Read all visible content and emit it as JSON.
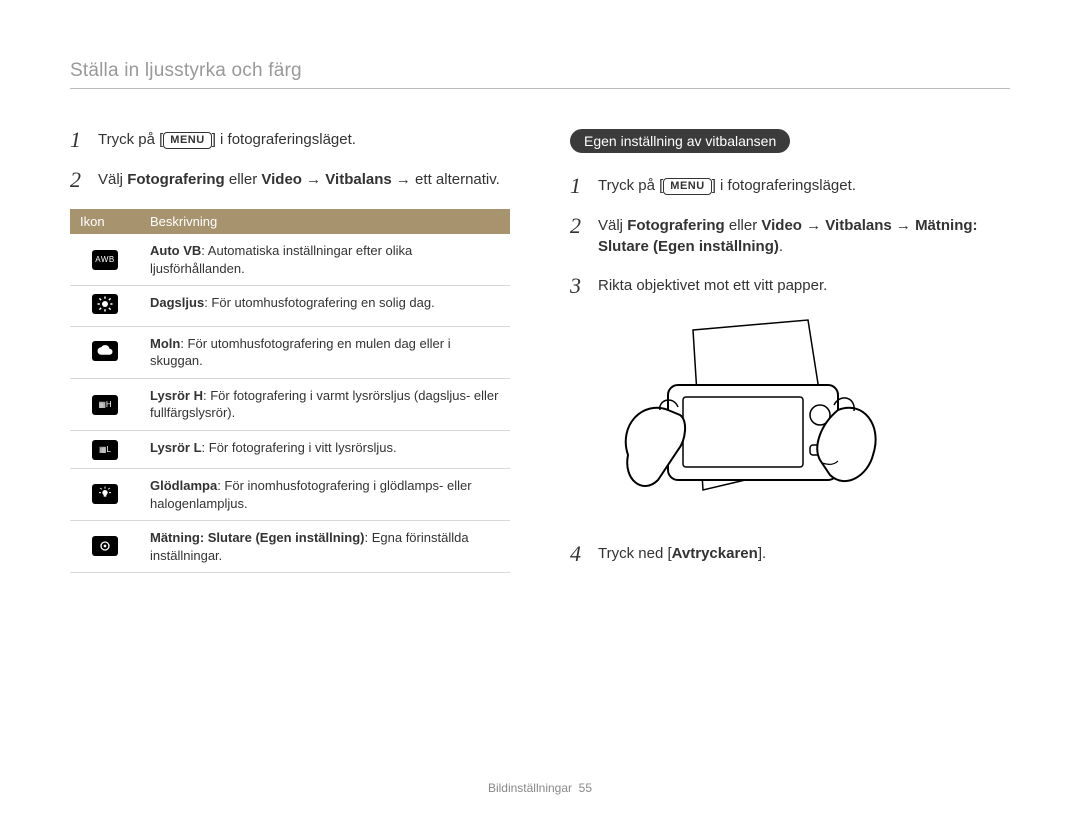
{
  "section_title": "Ställa in ljusstyrka och färg",
  "menu_label": "MENU",
  "left": {
    "steps": [
      {
        "num": "1",
        "pre": "Tryck på [",
        "post": "] i fotograferingsläget."
      },
      {
        "num": "2",
        "text_parts": [
          "Välj ",
          "Fotografering",
          " eller ",
          "Video",
          " → ",
          "Vitbalans",
          " → ett alternativ."
        ]
      }
    ]
  },
  "table": {
    "head_icon": "Ikon",
    "head_desc": "Beskrivning",
    "rows": [
      {
        "icon": "awb",
        "bold": "Auto VB",
        "rest": ": Automatiska inställningar efter olika ljusförhållanden."
      },
      {
        "icon": "sun",
        "bold": "Dagsljus",
        "rest": ": För utomhusfotografering en solig dag."
      },
      {
        "icon": "cloud",
        "bold": "Moln",
        "rest": ": För utomhusfotografering en mulen dag eller i skuggan."
      },
      {
        "icon": "fl-h",
        "bold": "Lysrör H",
        "rest": ": För fotografering i varmt lysrörsljus (dagsljus- eller fullfärgslysrör)."
      },
      {
        "icon": "fl-l",
        "bold": "Lysrör L",
        "rest": ": För fotografering i vitt lysrörsljus."
      },
      {
        "icon": "bulb",
        "bold": "Glödlampa",
        "rest": ": För inomhusfotografering i glödlamps- eller halogenlampljus."
      },
      {
        "icon": "measure",
        "bold": "Mätning: Slutare (Egen inställning)",
        "rest": ": Egna förinställda inställningar."
      }
    ]
  },
  "right": {
    "lozenge": "Egen inställning av vitbalansen",
    "steps": [
      {
        "num": "1",
        "pre": "Tryck på [",
        "post": "] i fotograferingsläget."
      },
      {
        "num": "2",
        "text_parts": [
          "Välj ",
          "Fotografering",
          " eller ",
          "Video",
          " → ",
          "Vitbalans",
          " → ",
          "Mätning: Slutare (Egen inställning)",
          "."
        ]
      },
      {
        "num": "3",
        "text": "Rikta objektivet mot ett vitt papper."
      },
      {
        "num": "4",
        "text_parts": [
          "Tryck ned [",
          "Avtryckaren",
          "]."
        ]
      }
    ]
  },
  "footer": {
    "section": "Bildinställningar",
    "page": "55"
  }
}
